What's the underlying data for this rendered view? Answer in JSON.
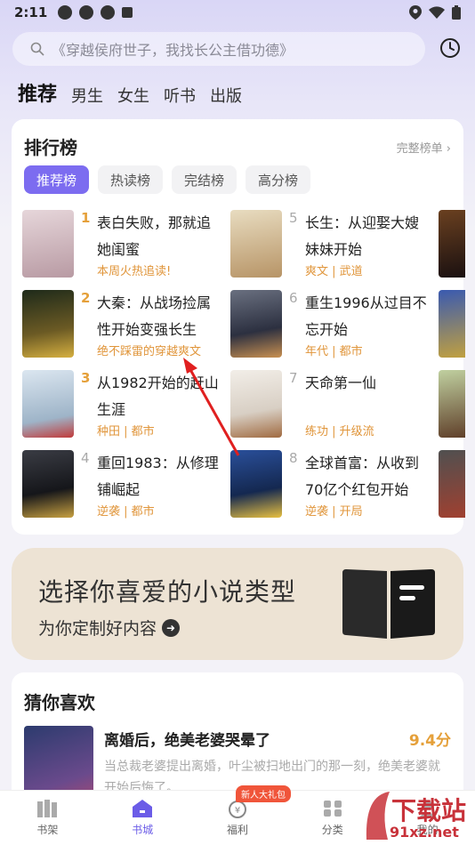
{
  "status_bar": {
    "time": "2:11"
  },
  "search": {
    "placeholder": "《穿越侯府世子，我找长公主借功德》"
  },
  "nav_tabs": [
    {
      "label": "推荐",
      "active": true
    },
    {
      "label": "男生",
      "active": false
    },
    {
      "label": "女生",
      "active": false
    },
    {
      "label": "听书",
      "active": false
    },
    {
      "label": "出版",
      "active": false
    }
  ],
  "ranking": {
    "title": "排行榜",
    "full_list": "完整榜单",
    "pills": [
      {
        "label": "推荐榜",
        "active": true
      },
      {
        "label": "热读榜",
        "active": false
      },
      {
        "label": "完结榜",
        "active": false
      },
      {
        "label": "高分榜",
        "active": false
      }
    ],
    "books": [
      {
        "num": "1",
        "title": "表白失败，那就追她闺蜜",
        "tag": "本周火热追读!",
        "cover_color": "#d8c7c9"
      },
      {
        "num": "2",
        "title": "大秦：从战场捡属性开始变强长生",
        "tag": "绝不踩雷的穿越爽文",
        "cover_color": "#3c3a2a"
      },
      {
        "num": "3",
        "title": "从1982开始的赶山生涯",
        "tag": "种田 | 都市",
        "cover_color": "#c7d4e2"
      },
      {
        "num": "4",
        "title": "重回1983：从修理铺崛起",
        "tag": "逆袭 | 都市",
        "cover_color": "#222428"
      },
      {
        "num": "5",
        "title": "长生：从迎娶大嫂妹妹开始",
        "tag": "爽文 | 武道",
        "cover_color": "#c8b08a"
      },
      {
        "num": "6",
        "title": "重生1996从过目不忘开始",
        "tag": "年代 | 都市",
        "cover_color": "#4a5060"
      },
      {
        "num": "7",
        "title": "天命第一仙",
        "tag": "练功 | 升级流",
        "cover_color": "#ebe6e0"
      },
      {
        "num": "8",
        "title": "全球首富：从收到70亿个红包开始",
        "tag": "逆袭 | 开局",
        "cover_color": "#1f3f7a"
      }
    ]
  },
  "promo": {
    "title": "选择你喜爱的小说类型",
    "subtitle": "为你定制好内容"
  },
  "guess": {
    "title": "猜你喜欢",
    "book_title": "离婚后，绝美老婆哭晕了",
    "score": "9.4分",
    "desc": "当总裁老婆提出离婚，叶尘被扫地出门的那一刻，绝美老婆就开始后悔了。"
  },
  "bottom_nav": [
    {
      "label": "书架",
      "active": false
    },
    {
      "label": "书城",
      "active": true
    },
    {
      "label": "福利",
      "active": false,
      "badge": "新人大礼包"
    },
    {
      "label": "分类",
      "active": false
    },
    {
      "label": "我的",
      "active": false
    }
  ],
  "watermark": {
    "text": "下载站",
    "url": "91xz.net"
  }
}
